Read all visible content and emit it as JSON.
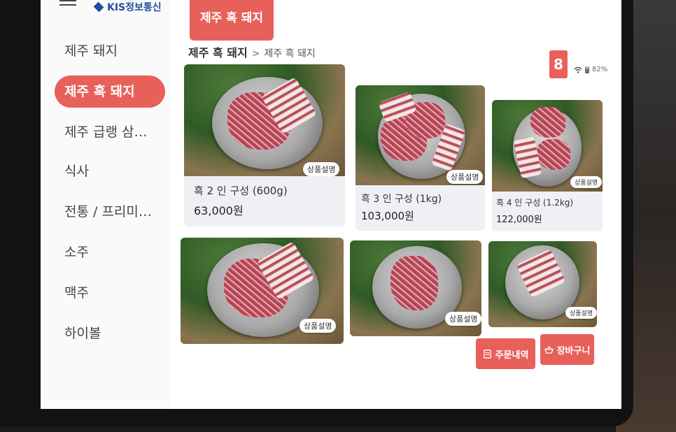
{
  "brand": {
    "logo_text": "KIS정보통신"
  },
  "sidebar": {
    "items": [
      {
        "label": "제주 돼지"
      },
      {
        "label": "제주 흑 돼지",
        "active": true
      },
      {
        "label": "제주 급랭 삼…"
      },
      {
        "label": "식사"
      },
      {
        "label": "전통 / 프리미…"
      },
      {
        "label": "소주"
      },
      {
        "label": "맥주"
      },
      {
        "label": "하이볼"
      }
    ]
  },
  "header": {
    "category_tab": "제주 흑 돼지",
    "breadcrumb": {
      "root": "제주 흑 돼지",
      "separator": ">",
      "current": "제주 흑 돼지"
    },
    "table_number": "8",
    "battery": "82%",
    "wifi_icon": "wifi-icon",
    "battery_icon": "battery-icon"
  },
  "products": [
    {
      "name": "흑 2 인 구성 (600g)",
      "price": "63,000원",
      "detail_label": "상품설명"
    },
    {
      "name": "흑 3 인 구성 (1kg)",
      "price": "103,000원",
      "detail_label": "상품설명"
    },
    {
      "name": "흑 4 인 구성 (1.2kg)",
      "price": "122,000원",
      "detail_label": "상품설명"
    },
    {
      "name": "",
      "price": "",
      "detail_label": "상품설명"
    },
    {
      "name": "",
      "price": "",
      "detail_label": "상품설명"
    },
    {
      "name": "",
      "price": "",
      "detail_label": "상품설명"
    }
  ],
  "footer": {
    "order_history": "주문내역",
    "cart": "장바구니"
  },
  "colors": {
    "accent": "#e8605a",
    "brand": "#1f4fa0"
  }
}
